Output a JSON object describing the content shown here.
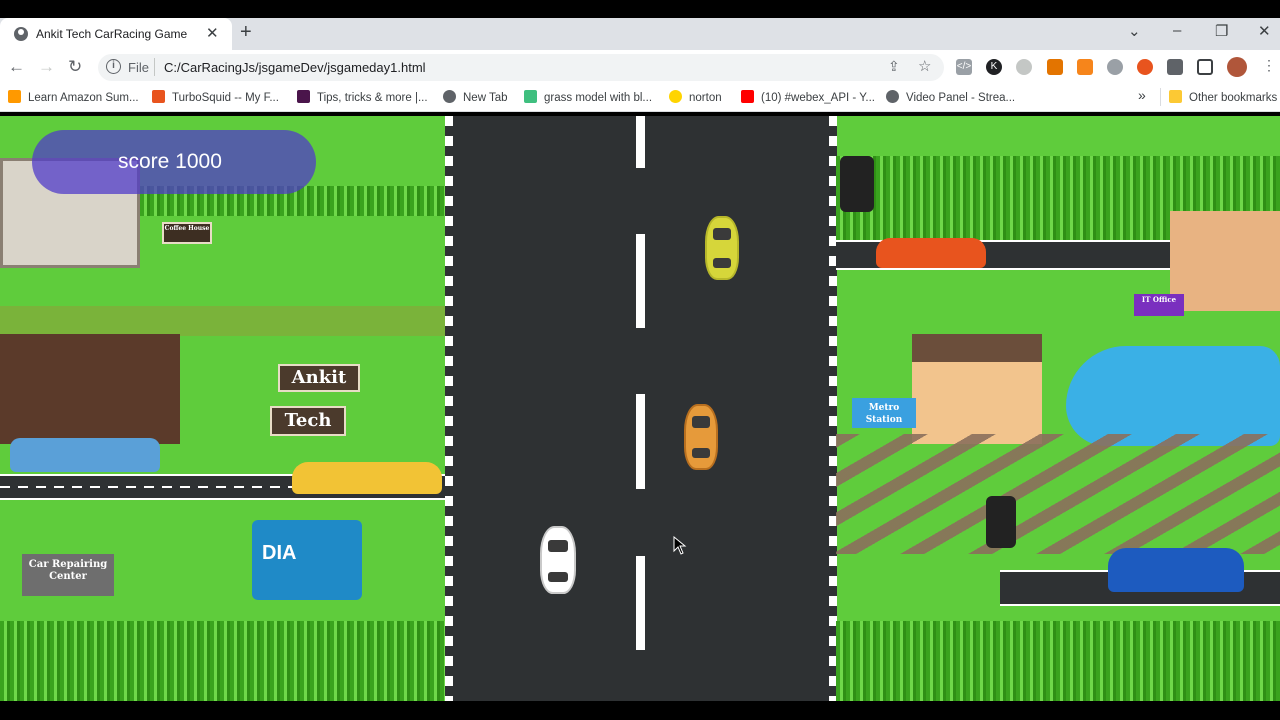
{
  "browser": {
    "tab_title": "Ankit Tech CarRacing Game",
    "tab_close": "✕",
    "new_tab": "+",
    "url_scheme": "File",
    "url": "C:/CarRacingJs/jsgameDev/jsgameday1.html",
    "window_controls": {
      "chevron": "⌄",
      "minimize": "–",
      "restore": "❐",
      "close": "✕"
    }
  },
  "bookmarks": [
    {
      "label": "Learn Amazon Sum...",
      "icon": "amazon-icon",
      "color": "#ff9900"
    },
    {
      "label": "TurboSquid -- My F...",
      "icon": "turbosquid-icon",
      "color": "#e8541e"
    },
    {
      "label": "Tips, tricks & more |...",
      "icon": "slack-icon",
      "color": "#4a154b"
    },
    {
      "label": "New Tab",
      "icon": "globe-icon",
      "color": "#5f6368"
    },
    {
      "label": "grass model with bl...",
      "icon": "image-icon",
      "color": "#3fbf7f"
    },
    {
      "label": "norton",
      "icon": "norton-icon",
      "color": "#ffd400"
    },
    {
      "label": "(10) #webex_API - Y...",
      "icon": "youtube-icon",
      "color": "#ff0000"
    },
    {
      "label": "Video Panel - Strea...",
      "icon": "globe-icon",
      "color": "#5f6368"
    }
  ],
  "bookmarks_overflow": "»",
  "other_bookmarks": "Other bookmarks",
  "game": {
    "score_text": "score 1000",
    "signs": {
      "ankit": "Ankit",
      "tech": "Tech",
      "coffee": "Coffee House",
      "car_repair": "Car Repairing Center",
      "truck": "DIA",
      "it_office": "IT Office",
      "metro": "Metro Station"
    },
    "colors": {
      "road": "#2e3133",
      "grass": "#5fcc3c",
      "player_car": "#ffffff",
      "enemy_car_1": "#d6d63a",
      "enemy_car_2": "#e69a3a"
    }
  }
}
